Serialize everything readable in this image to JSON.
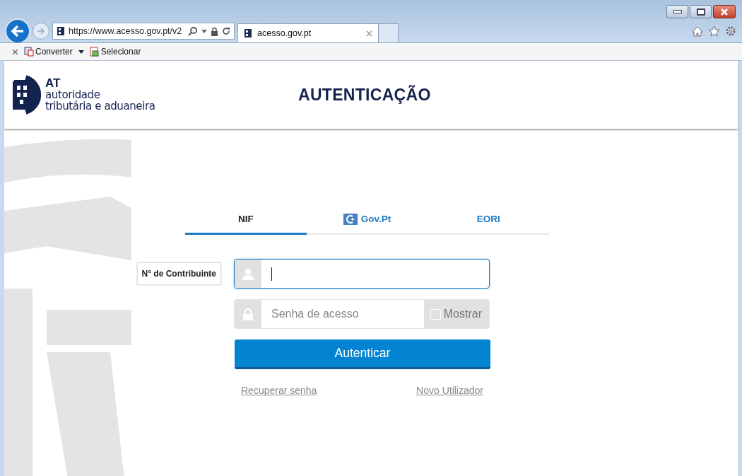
{
  "browser": {
    "address": "https://www.acesso.gov.pt/v2",
    "tab": {
      "title": "acesso.gov.pt"
    }
  },
  "toolbar": {
    "items": [
      "Converter",
      "Selecionar"
    ]
  },
  "header": {
    "logo": {
      "mark": "AT",
      "line_1": "autoridade",
      "line_2": "tributária e aduaneira"
    },
    "title": "AUTENTICAÇÃO"
  },
  "login": {
    "tabs": [
      {
        "label": "NIF",
        "selected": true,
        "kind": "text"
      },
      {
        "label": "Gov.Pt",
        "selected": false,
        "kind": "icon"
      },
      {
        "label": "EORI",
        "selected": false,
        "kind": "text"
      }
    ],
    "nif_label": "N° de Contribuinte",
    "password": {
      "placeholder": "Senha de acesso"
    },
    "show_password": {
      "label": "Mostrar",
      "checked": false
    },
    "submit": "Autenticar",
    "links": [
      "Recuperar senha",
      "Novo Utilizador"
    ]
  }
}
